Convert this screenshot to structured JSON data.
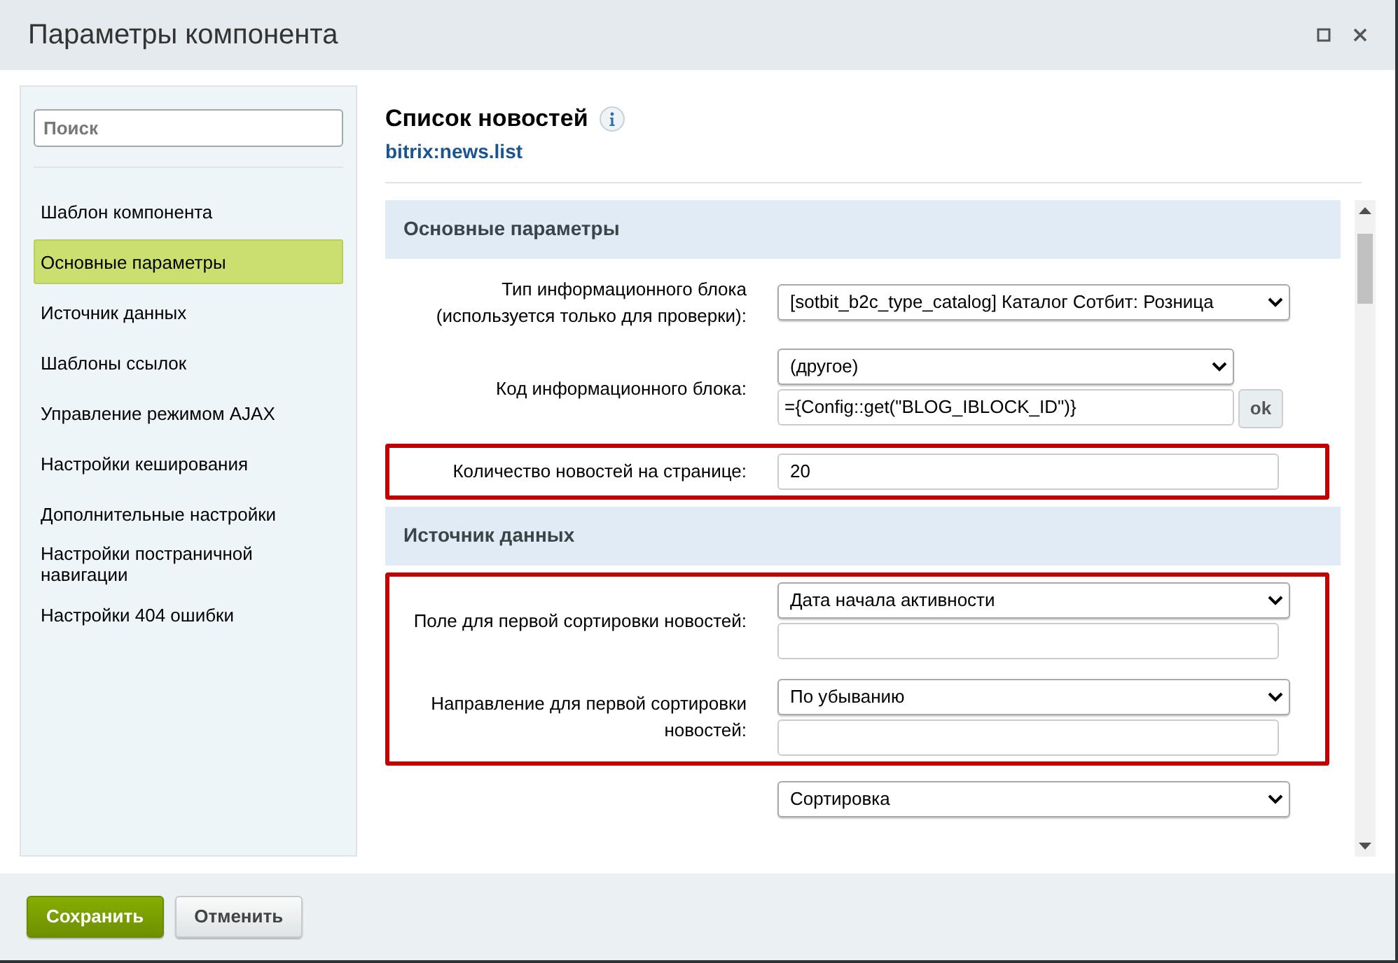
{
  "window": {
    "title": "Параметры компонента"
  },
  "sidebar": {
    "search": {
      "placeholder": "Поиск"
    },
    "items": [
      {
        "label": "Шаблон компонента",
        "selected": false
      },
      {
        "label": "Основные параметры",
        "selected": true
      },
      {
        "label": "Источник данных",
        "selected": false
      },
      {
        "label": "Шаблоны ссылок",
        "selected": false
      },
      {
        "label": "Управление режимом AJAX",
        "selected": false
      },
      {
        "label": "Настройки кеширования",
        "selected": false
      },
      {
        "label": "Дополнительные настройки",
        "selected": false
      },
      {
        "label": "Настройки постраничной навигации",
        "selected": false
      },
      {
        "label": "Настройки 404 ошибки",
        "selected": false
      }
    ]
  },
  "component": {
    "title": "Список новостей",
    "code": "bitrix:news.list"
  },
  "sections": [
    {
      "title": "Основные параметры",
      "groups": [
        {
          "highlighted": false,
          "fields": [
            {
              "kind": "select",
              "label": "Тип информационного блока (используется только для проверки):",
              "value": "[sotbit_b2c_type_catalog] Каталог Сотбит: Розница"
            },
            {
              "kind": "select_ok",
              "label": "Код информационного блока:",
              "value": "(другое)",
              "input": "={Config::get(\"BLOG_IBLOCK_ID\")}",
              "button": "ok"
            }
          ]
        },
        {
          "highlighted": true,
          "fields": [
            {
              "kind": "input",
              "label": "Количество новостей на странице:",
              "input": "20"
            }
          ]
        }
      ]
    },
    {
      "title": "Источник данных",
      "groups": [
        {
          "highlighted": true,
          "fields": [
            {
              "kind": "select_input",
              "label": "Поле для первой сортировки новостей:",
              "value": "Дата начала активности"
            },
            {
              "kind": "select_input",
              "label": "Направление для первой сортировки новостей:",
              "value": "По убыванию"
            }
          ]
        },
        {
          "highlighted": false,
          "fields": [
            {
              "kind": "select",
              "value": "Сортировка"
            }
          ]
        }
      ]
    }
  ],
  "buttons": [
    {
      "label": "Сохранить",
      "kind": "primary"
    },
    {
      "label": "Отменить",
      "kind": "secondary"
    }
  ]
}
